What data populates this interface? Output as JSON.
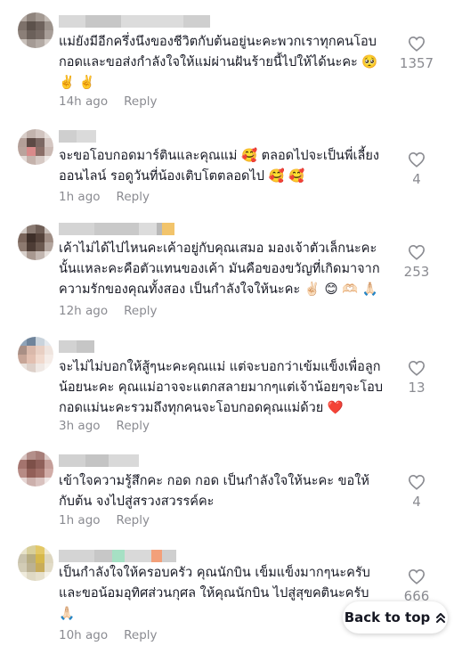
{
  "comments": [
    {
      "text": "แม่ยังมีอีกครึ่งนึงของชีวิตกับต้นอยู่นะคะพวกเราทุกคนโอบ\nกอดและขอส่งกำลังใจให้แม่ผ่านฝันร้ายนี้ไปให้ได้นะคะ 🥺\n✌️ ✌️",
      "time": "14h ago",
      "reply": "Reply",
      "likes": "1357"
    },
    {
      "text": "จะขอโอบกอดมาร์ตินและคุณแม่ 🥰 ตลอดไปจะเป็นพี่เลี้ยง\nออนไลน์ รอดูวันที่น้องเติบโตตลอดไป 🥰 🥰",
      "time": "1h ago",
      "reply": "Reply",
      "likes": "4"
    },
    {
      "text": "เค้าไม่ได้ไปไหนคะเค้าอยู่กับคุณเสมอ มองเจ้าตัวเล็กนะคะ\nนั้นแหละคะคือตัวแทนของเค้า มันคือของขวัญที่เกิดมาจาก\nความรักของคุณทั้งสอง เป็นกำลังใจให้นะคะ ✌🏻 😊 🫶🏻 🙏🏻",
      "time": "12h ago",
      "reply": "Reply",
      "likes": "253"
    },
    {
      "text": "จะไม่ไม่บอกให้สู้ๆนะคะคุณแม่ แต่จะบอกว่าเข้มแข็งเพื่อลูก\nน้อยนะคะ คุณแม่อาจจะแตกสลายมากๆแต่เจ้าน้อยๆจะโอบ\nกอดแม่นะคะรวมถึงทุกคนจะโอบกอดคุณแม่ด้วย ❤️",
      "time": "3h ago",
      "reply": "Reply",
      "likes": "13"
    },
    {
      "text": "เข้าใจความรู้สึกคะ กอด กอด เป็นกำลังใจให้นะคะ ขอให้\nกับต้น จงไปสู่สรวงสวรรค์คะ",
      "time": "1h ago",
      "reply": "Reply",
      "likes": "4"
    },
    {
      "text": "เป็นกำลังใจให้ครอบครัว คุณนักบิน เข็มแข็งมากๆนะครับ\nและขอน้อมอุทิศส่วนกุศล ให้คุณนักบิน ไปสู่สุขคตินะครับ\n🙏🏻",
      "time": "10h ago",
      "reply": "Reply",
      "likes": "666"
    }
  ],
  "back_to_top": {
    "label": "Back to top",
    "icon": "double-chevron-up-icon"
  },
  "colors": {
    "text": "#161823",
    "muted": "#8a8b91",
    "heart_outline": "#8a8b91"
  }
}
